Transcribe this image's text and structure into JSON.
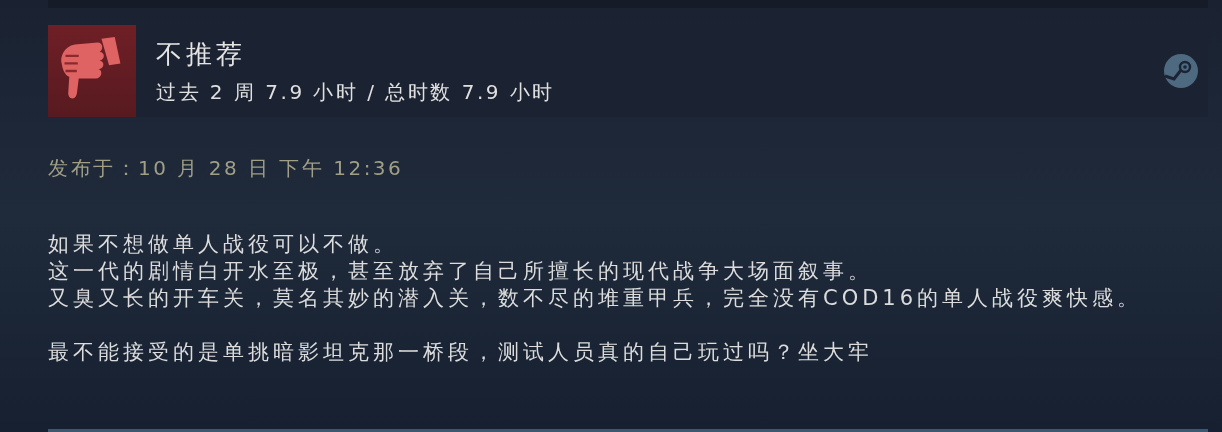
{
  "review": {
    "recommended": false,
    "verdict": "不推荐",
    "hours": "过去 2 周 7.9 小时 / 总时数 7.9 小时",
    "posted": "发布于：10 月 28 日 下午 12:36",
    "paragraphs": [
      [
        "如果不想做单人战役可以不做。",
        "这一代的剧情白开水至极，甚至放弃了自己所擅长的现代战争大场面叙事。",
        "又臭又长的开车关，莫名其妙的潜入关，数不尽的堆重甲兵，完全没有COD16的单人战役爽快感。"
      ],
      [
        "最不能接受的是单挑暗影坦克那一桥段，测试人员真的自己玩过吗？坐大牢"
      ]
    ]
  }
}
